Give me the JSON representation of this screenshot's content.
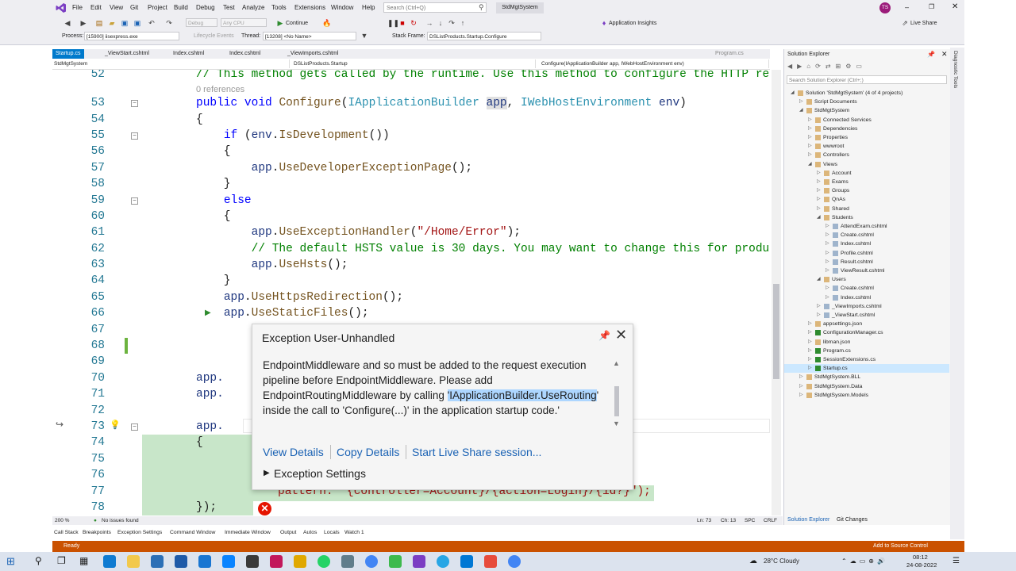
{
  "menubar": {
    "items": [
      "File",
      "Edit",
      "View",
      "Git",
      "Project",
      "Build",
      "Debug",
      "Test",
      "Analyze",
      "Tools",
      "Extensions",
      "Window",
      "Help"
    ],
    "search_placeholder": "Search (Ctrl+Q)",
    "solution_name": "StdMgtSystem",
    "user_initials": "TS"
  },
  "toolbar": {
    "config": "Debug",
    "platform": "Any CPU",
    "continue_label": "Continue",
    "app_insights": "Application Insights",
    "live_share": "Live Share",
    "process_label": "Process:",
    "process_value": "[15900] iisexpress.exe",
    "lifecycle_label": "Lifecycle Events",
    "thread_label": "Thread:",
    "thread_value": "[13208] <No Name>",
    "stack_label": "Stack Frame:",
    "stack_value": "DSListProducts.Startup.Configure"
  },
  "tabs": [
    "Startup.cs",
    "_ViewStart.cshtml",
    "Index.cshtml",
    "Index.cshtml",
    "_ViewImports.cshtml",
    "Program.cs"
  ],
  "navbar": {
    "project": "StdMgtSystem",
    "class": "DSListProducts.Startup",
    "method": "Configure(IApplicationBuilder app, IWebHostEnvironment env)"
  },
  "editor": {
    "refs_text": "0 references",
    "line_numbers": [
      "52",
      "53",
      "54",
      "55",
      "56",
      "57",
      "58",
      "59",
      "60",
      "61",
      "62",
      "63",
      "64",
      "65",
      "66",
      "67",
      "68",
      "69",
      "70",
      "71",
      "72",
      "73",
      "74",
      "75",
      "76",
      "77",
      "78"
    ],
    "partial_code": {
      "l70": "app.",
      "l71": "app.",
      "l73": "app.",
      "l74": "{",
      "l77": "pattern: \"{controller=Account}/{action=Login}/{id?}\");",
      "l78": "});"
    }
  },
  "exception": {
    "title": "Exception User-Unhandled",
    "message_pre": "EndpointMiddleware and so must be added to the request execution pipeline before EndpointMiddleware. Please add EndpointRoutingMiddleware by calling ",
    "message_hl": "'IApplicationBuilder.UseRouting",
    "message_post": "' inside the call to 'Configure(...)' in the application startup code.'",
    "link_view": "View Details",
    "link_copy": "Copy Details",
    "link_share": "Start Live Share session...",
    "settings": "Exception Settings"
  },
  "solution_explorer": {
    "title": "Solution Explorer",
    "search_placeholder": "Search Solution Explorer (Ctrl+;)",
    "items": [
      {
        "label": "Solution 'StdMgtSystem' (4 of 4 projects)",
        "indent": 0
      },
      {
        "label": "Script Documents",
        "indent": 1
      },
      {
        "label": "StdMgtSystem",
        "indent": 1
      },
      {
        "label": "Connected Services",
        "indent": 2
      },
      {
        "label": "Dependencies",
        "indent": 2
      },
      {
        "label": "Properties",
        "indent": 2
      },
      {
        "label": "wwwroot",
        "indent": 2
      },
      {
        "label": "Controllers",
        "indent": 2
      },
      {
        "label": "Views",
        "indent": 2
      },
      {
        "label": "Account",
        "indent": 3
      },
      {
        "label": "Exams",
        "indent": 3
      },
      {
        "label": "Groups",
        "indent": 3
      },
      {
        "label": "QnAs",
        "indent": 3
      },
      {
        "label": "Shared",
        "indent": 3
      },
      {
        "label": "Students",
        "indent": 3
      },
      {
        "label": "AttendExam.cshtml",
        "indent": 4
      },
      {
        "label": "Create.cshtml",
        "indent": 4
      },
      {
        "label": "Index.cshtml",
        "indent": 4
      },
      {
        "label": "Profile.cshtml",
        "indent": 4
      },
      {
        "label": "Result.cshtml",
        "indent": 4
      },
      {
        "label": "ViewResult.cshtml",
        "indent": 4
      },
      {
        "label": "Users",
        "indent": 3
      },
      {
        "label": "Create.cshtml",
        "indent": 4
      },
      {
        "label": "Index.cshtml",
        "indent": 4
      },
      {
        "label": "_ViewImports.cshtml",
        "indent": 3
      },
      {
        "label": "_ViewStart.cshtml",
        "indent": 3
      },
      {
        "label": "appsettings.json",
        "indent": 2
      },
      {
        "label": "ConfigurationManager.cs",
        "indent": 2
      },
      {
        "label": "libman.json",
        "indent": 2
      },
      {
        "label": "Program.cs",
        "indent": 2
      },
      {
        "label": "SessionExtensions.cs",
        "indent": 2
      },
      {
        "label": "Startup.cs",
        "indent": 2
      },
      {
        "label": "StdMgtSystem.BLL",
        "indent": 1
      },
      {
        "label": "StdMgtSystem.Data",
        "indent": 1
      },
      {
        "label": "StdMgtSystem.Models",
        "indent": 1
      }
    ],
    "tab_solution": "Solution Explorer",
    "tab_git": "Git Changes"
  },
  "right_strip_label": "Diagnostic Tools",
  "statusline": {
    "zoom": "200 %",
    "issues": "No issues found",
    "ln": "Ln: 73",
    "ch": "Ch: 13",
    "spc": "SPC",
    "crlf": "CRLF"
  },
  "bottom_tabs": [
    "Call Stack",
    "Breakpoints",
    "Exception Settings",
    "Command Window",
    "Immediate Window",
    "Output",
    "Autos",
    "Locals",
    "Watch 1"
  ],
  "status_bar": {
    "state": "Ready",
    "source_control": "Add to Source Control"
  },
  "taskbar": {
    "weather": "28°C  Cloudy",
    "time": "08:12",
    "date": "24-08-2022"
  }
}
